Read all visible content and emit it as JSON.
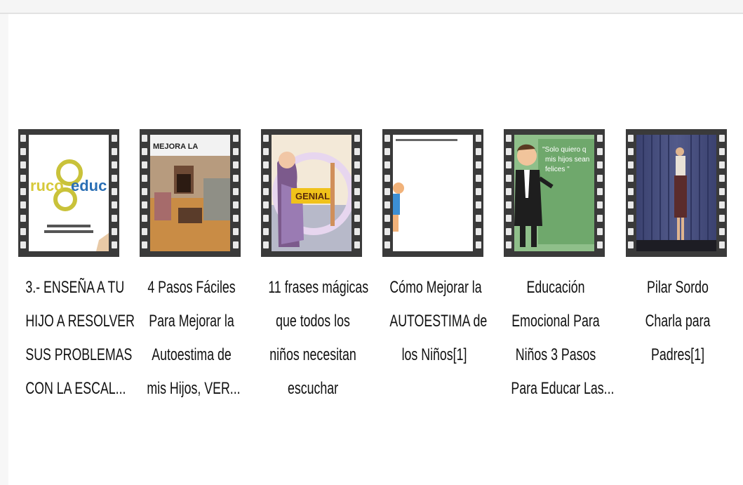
{
  "files": [
    {
      "name_lines": [
        "3.- ENSEÑA A TU",
        "HIJO A RESOLVER",
        "SUS PROBLEMAS",
        "CON LA ESCAL..."
      ],
      "thumb_text": "ruco",
      "thumb_text2": "educ",
      "icon": "video-file-icon"
    },
    {
      "name_lines": [
        "4 Pasos Fáciles",
        "Para Mejorar la",
        "Autoestima de",
        "mis Hijos, VER..."
      ],
      "thumb_text": "MEJORA LA",
      "icon": "video-file-icon"
    },
    {
      "name_lines": [
        "11 frases mágicas",
        "que todos los",
        "niños necesitan",
        "escuchar"
      ],
      "thumb_text": "GENIAL",
      "icon": "video-file-icon"
    },
    {
      "name_lines": [
        "Cómo Mejorar la",
        "AUTOESTIMA de",
        "los Niños[1]"
      ],
      "icon": "video-file-icon"
    },
    {
      "name_lines": [
        "Educación",
        "Emocional Para",
        "Niños 3 Pasos",
        "Para Educar Las..."
      ],
      "thumb_text": "\"Solo quiero q",
      "thumb_text2": "mis hijos sean",
      "thumb_text3": "felices \"",
      "icon": "video-file-icon"
    },
    {
      "name_lines": [
        "Pilar Sordo",
        "Charla para",
        "Padres[1]"
      ],
      "icon": "video-file-icon"
    }
  ]
}
